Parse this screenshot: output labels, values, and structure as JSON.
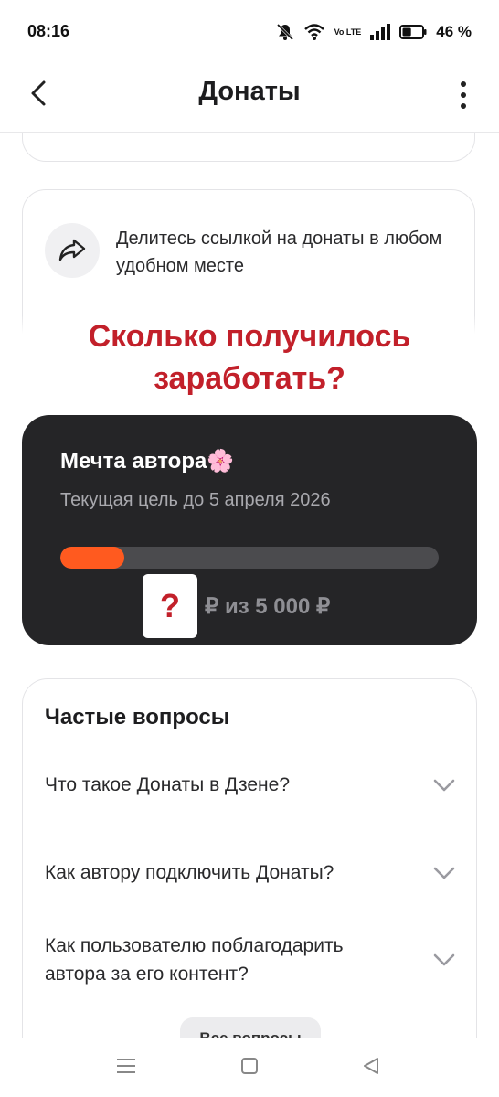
{
  "status_bar": {
    "time": "08:16",
    "network": "Vo LTE",
    "battery_percent": "46 %",
    "battery_level": 0.46
  },
  "header": {
    "title": "Донаты"
  },
  "share_card": {
    "text": "Делитесь ссылкой на донаты в любом удобном месте"
  },
  "overlay": {
    "question": "Сколько получилось заработать?"
  },
  "goal": {
    "title": "Мечта автора",
    "emoji": "🌸",
    "subtitle": "Текущая цель до 5 апреля 2026",
    "progress_fraction": 0.17,
    "hidden_amount": "?",
    "amount_suffix": "₽ из 5 000 ₽",
    "colors": {
      "card": "#252527",
      "fill": "#ff5a1f",
      "track": "#4b4b4e"
    }
  },
  "faq": {
    "title": "Частые вопросы",
    "items": [
      {
        "question": "Что такое Донаты в Дзене?"
      },
      {
        "question": "Как автору подключить Донаты?"
      },
      {
        "question": "Как пользователю поблагодарить автора за его контент?"
      }
    ],
    "all_button": "Все вопросы"
  },
  "icons": {
    "back": "back-arrow-icon",
    "more": "more-vertical-icon",
    "share": "share-arrow-icon",
    "chevron": "chevron-down-icon",
    "nav": [
      "menu-icon",
      "home-icon",
      "back-triangle-icon"
    ]
  },
  "accent_color": "#c2202a"
}
